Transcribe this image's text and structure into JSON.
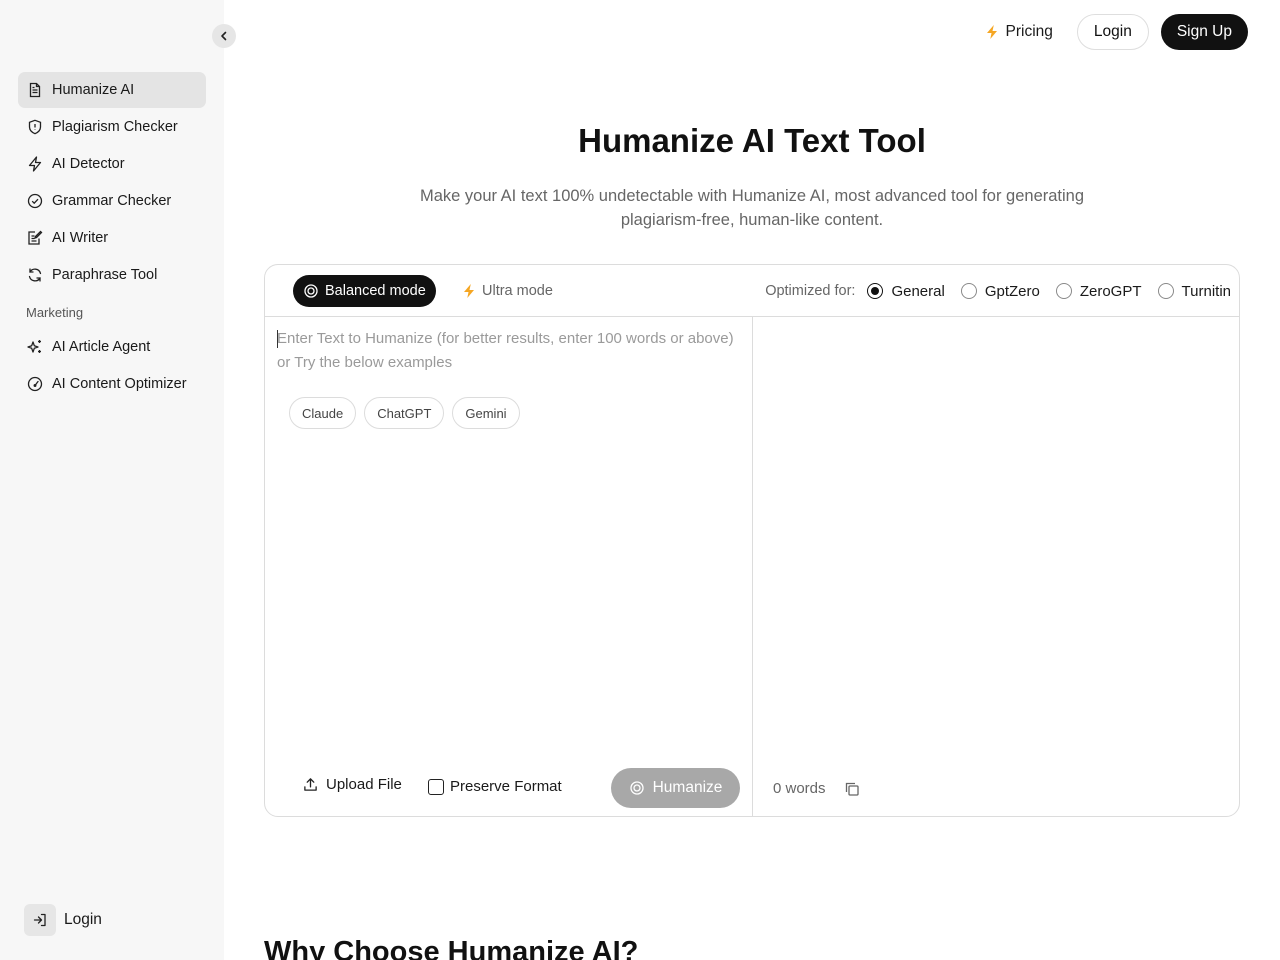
{
  "sidebar": {
    "items": [
      {
        "label": "Humanize AI",
        "icon": "document-icon"
      },
      {
        "label": "Plagiarism Checker",
        "icon": "shield-icon"
      },
      {
        "label": "AI Detector",
        "icon": "lightning-icon"
      },
      {
        "label": "Grammar Checker",
        "icon": "check-circle-icon"
      },
      {
        "label": "AI Writer",
        "icon": "edit-note-icon"
      },
      {
        "label": "Paraphrase Tool",
        "icon": "refresh-icon"
      }
    ],
    "section_label": "Marketing",
    "marketing_items": [
      {
        "label": "AI Article Agent",
        "icon": "sparkles-icon"
      },
      {
        "label": "AI Content Optimizer",
        "icon": "gauge-icon"
      }
    ],
    "login_label": "Login"
  },
  "header": {
    "pricing_label": "Pricing",
    "login_label": "Login",
    "signup_label": "Sign Up"
  },
  "hero": {
    "title": "Humanize AI Text Tool",
    "subtitle": "Make your AI text 100% undetectable with Humanize AI, most advanced tool for generating plagiarism-free, human-like content."
  },
  "tool": {
    "modes": {
      "balanced": "Balanced mode",
      "ultra": "Ultra mode"
    },
    "optimized_label": "Optimized for:",
    "targets": [
      "General",
      "GptZero",
      "ZeroGPT",
      "Turnitin"
    ],
    "selected_target": "General",
    "input_placeholder": "Enter Text to Humanize (for better results, enter 100 words or above) or Try the below examples",
    "input_value": "",
    "examples": [
      "Claude",
      "ChatGPT",
      "Gemini"
    ],
    "upload_label": "Upload File",
    "preserve_label": "Preserve Format",
    "humanize_label": "Humanize",
    "word_count": "0 words"
  },
  "next_section": {
    "title": "Why Choose Humanize AI?"
  },
  "colors": {
    "accent_dark": "#111111",
    "bolt": "#f5a623",
    "disabled_button": "#a8a8a8"
  }
}
